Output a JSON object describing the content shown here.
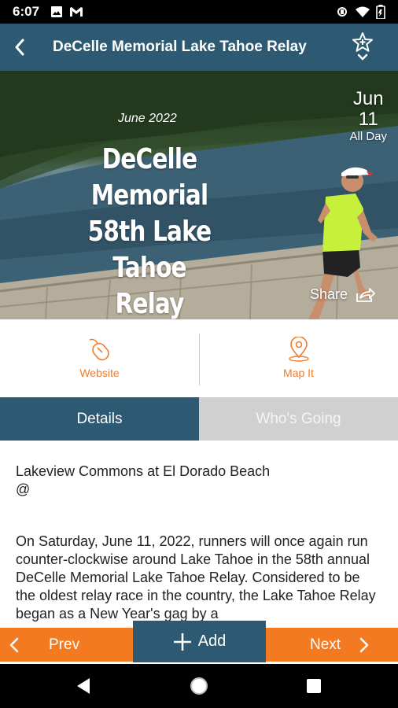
{
  "status_bar": {
    "time": "6:07",
    "left_icons": [
      "image-icon",
      "gmail-icon"
    ],
    "right_icons": [
      "vibrate-icon",
      "wifi-icon",
      "battery-icon"
    ]
  },
  "app_bar": {
    "title": "DeCelle Memorial Lake Tahoe Relay",
    "back_icon": "chevron-left-icon",
    "favorite_icon": "star-add-icon"
  },
  "hero": {
    "kicker": "June 2022",
    "title_lines": [
      "DeCelle Memorial",
      "58th Lake Tahoe",
      "Relay"
    ],
    "date": {
      "month": "Jun",
      "day": "11",
      "time": "All Day"
    },
    "share_label": "Share"
  },
  "actions": {
    "website_label": "Website",
    "mapit_label": "Map It"
  },
  "tabs": {
    "details": "Details",
    "whos_going": "Who's Going"
  },
  "details": {
    "venue": "Lakeview Commons at El Dorado Beach",
    "at": "@",
    "description": "On Saturday, June 11, 2022, runners will once again run counter-clockwise around Lake Tahoe in the 58th annual DeCelle Memorial Lake Tahoe Relay. Considered to be the oldest relay race in the country, the Lake Tahoe Relay began as a New Year's gag by a"
  },
  "bottom_nav": {
    "prev": "Prev",
    "add": "Add",
    "next": "Next"
  },
  "colors": {
    "primary": "#2d5a72",
    "accent": "#f47a22",
    "tab_inactive": "#d0d0d0"
  }
}
